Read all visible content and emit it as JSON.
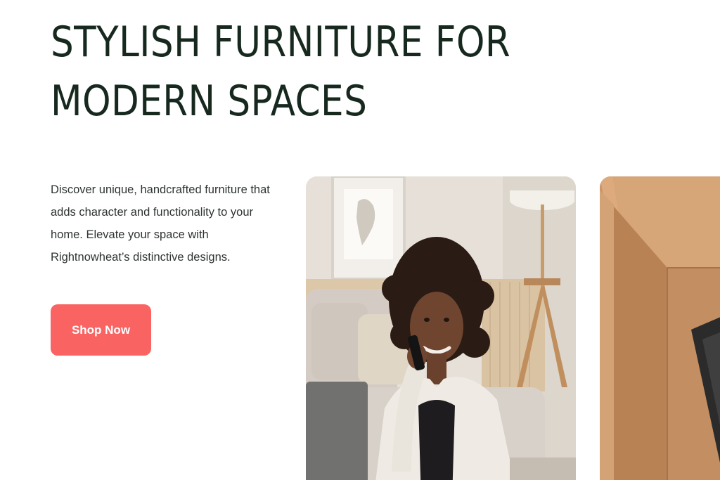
{
  "hero": {
    "title": "STYLISH FURNITURE FOR MODERN SPACES",
    "description": "Discover unique, handcrafted furniture that adds character and functionality to your home. Elevate your space with Rightnowheat’s distinctive designs.",
    "cta_label": "Shop Now"
  },
  "gallery": {
    "images": [
      {
        "icon": "woman-on-phone-photo"
      },
      {
        "icon": "cardboard-box-photo"
      }
    ]
  },
  "colors": {
    "heading": "#17291f",
    "body_text": "#2e3430",
    "cta_background": "#f96463",
    "cta_text": "#ffffff",
    "background": "#ffffff"
  }
}
